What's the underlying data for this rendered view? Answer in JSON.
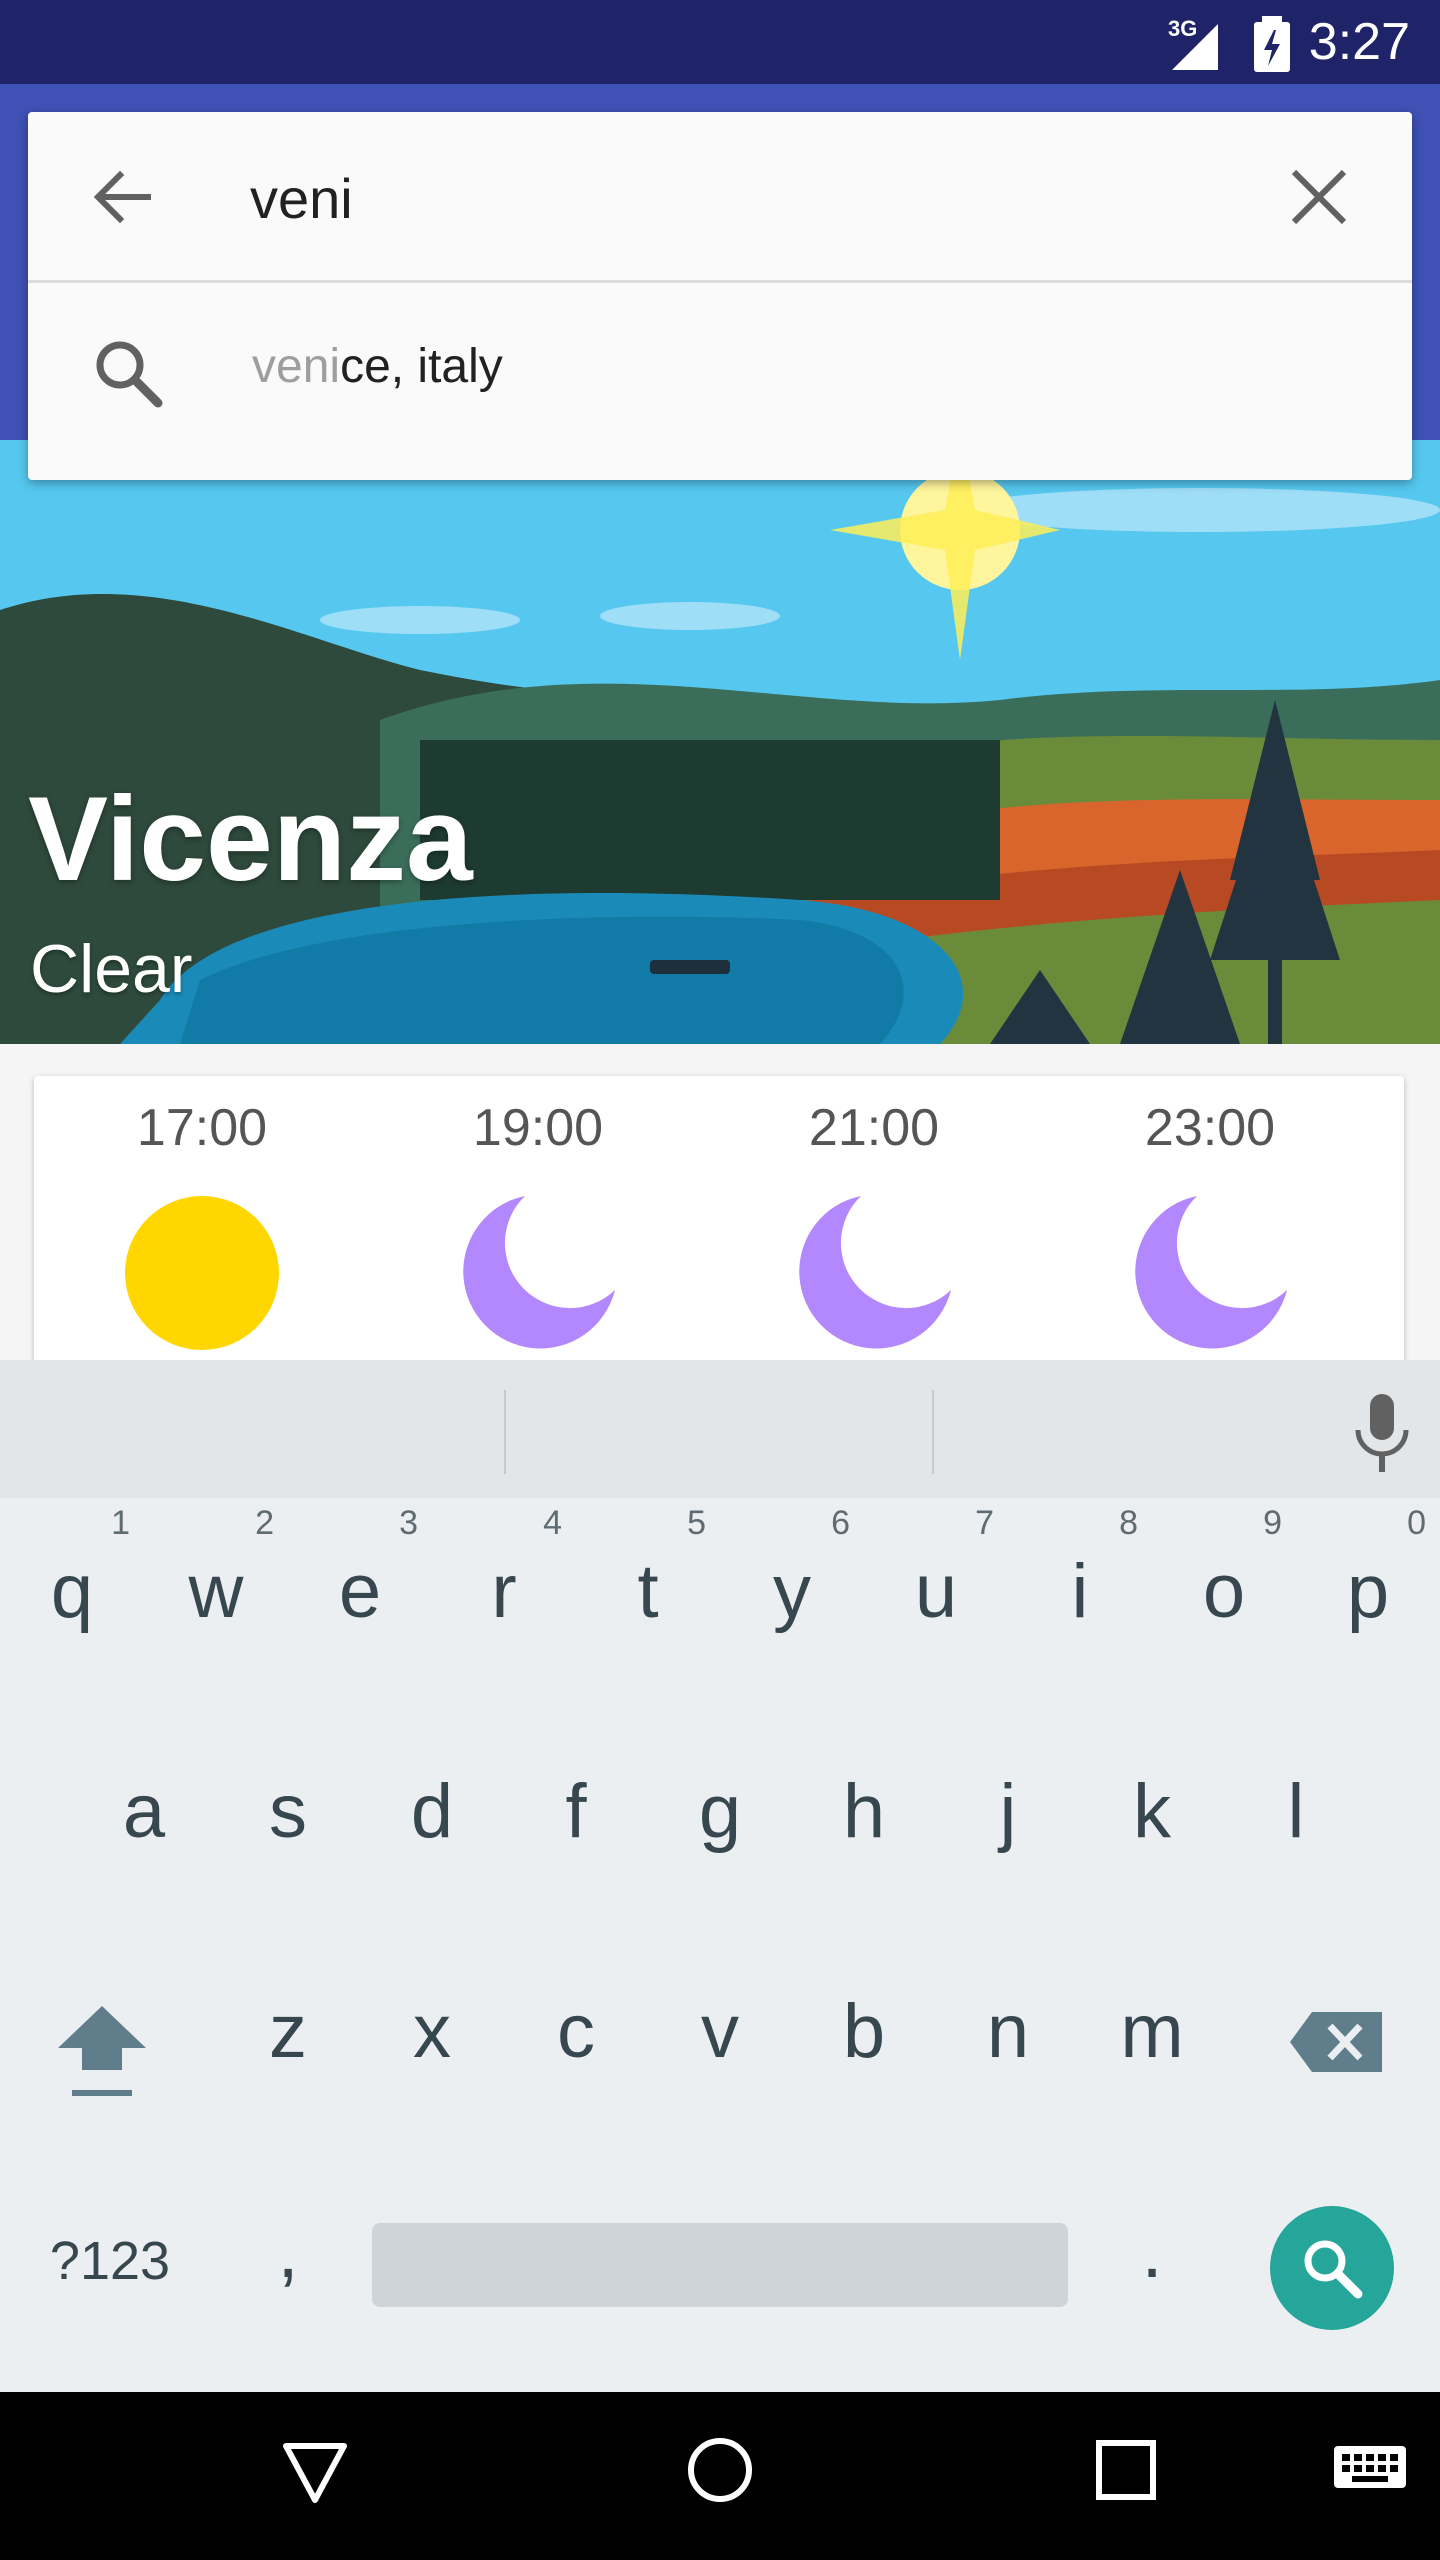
{
  "status_bar": {
    "network": "3G",
    "time": "3:27",
    "colors": {
      "background": "#1f2368",
      "app_bar": "#3f51b5"
    }
  },
  "search": {
    "query": "veni",
    "back_icon": "arrow-back-icon",
    "clear_icon": "close-icon",
    "suggestion": {
      "icon": "search-icon",
      "matched": "veni",
      "rest": "ce, italy"
    }
  },
  "weather": {
    "city": "Vicenza",
    "condition": "Clear",
    "forecast": [
      {
        "time": "17:00",
        "icon": "sun-icon",
        "color": "#ffd600"
      },
      {
        "time": "19:00",
        "icon": "moon-icon",
        "color": "#b388ff"
      },
      {
        "time": "21:00",
        "icon": "moon-icon",
        "color": "#b388ff"
      },
      {
        "time": "23:00",
        "icon": "moon-icon",
        "color": "#b388ff"
      }
    ]
  },
  "keyboard": {
    "row1": [
      {
        "key": "q",
        "hint": "1"
      },
      {
        "key": "w",
        "hint": "2"
      },
      {
        "key": "e",
        "hint": "3"
      },
      {
        "key": "r",
        "hint": "4"
      },
      {
        "key": "t",
        "hint": "5"
      },
      {
        "key": "y",
        "hint": "6"
      },
      {
        "key": "u",
        "hint": "7"
      },
      {
        "key": "i",
        "hint": "8"
      },
      {
        "key": "o",
        "hint": "9"
      },
      {
        "key": "p",
        "hint": "0"
      }
    ],
    "row2": [
      "a",
      "s",
      "d",
      "f",
      "g",
      "h",
      "j",
      "k",
      "l"
    ],
    "row3": [
      "z",
      "x",
      "c",
      "v",
      "b",
      "n",
      "m"
    ],
    "symbols_label": "?123",
    "comma": ",",
    "period": ".",
    "accent": "#26a69a"
  },
  "nav": {
    "back": "back-icon",
    "home": "home-icon",
    "recents": "recents-icon",
    "ime": "keyboard-icon"
  }
}
